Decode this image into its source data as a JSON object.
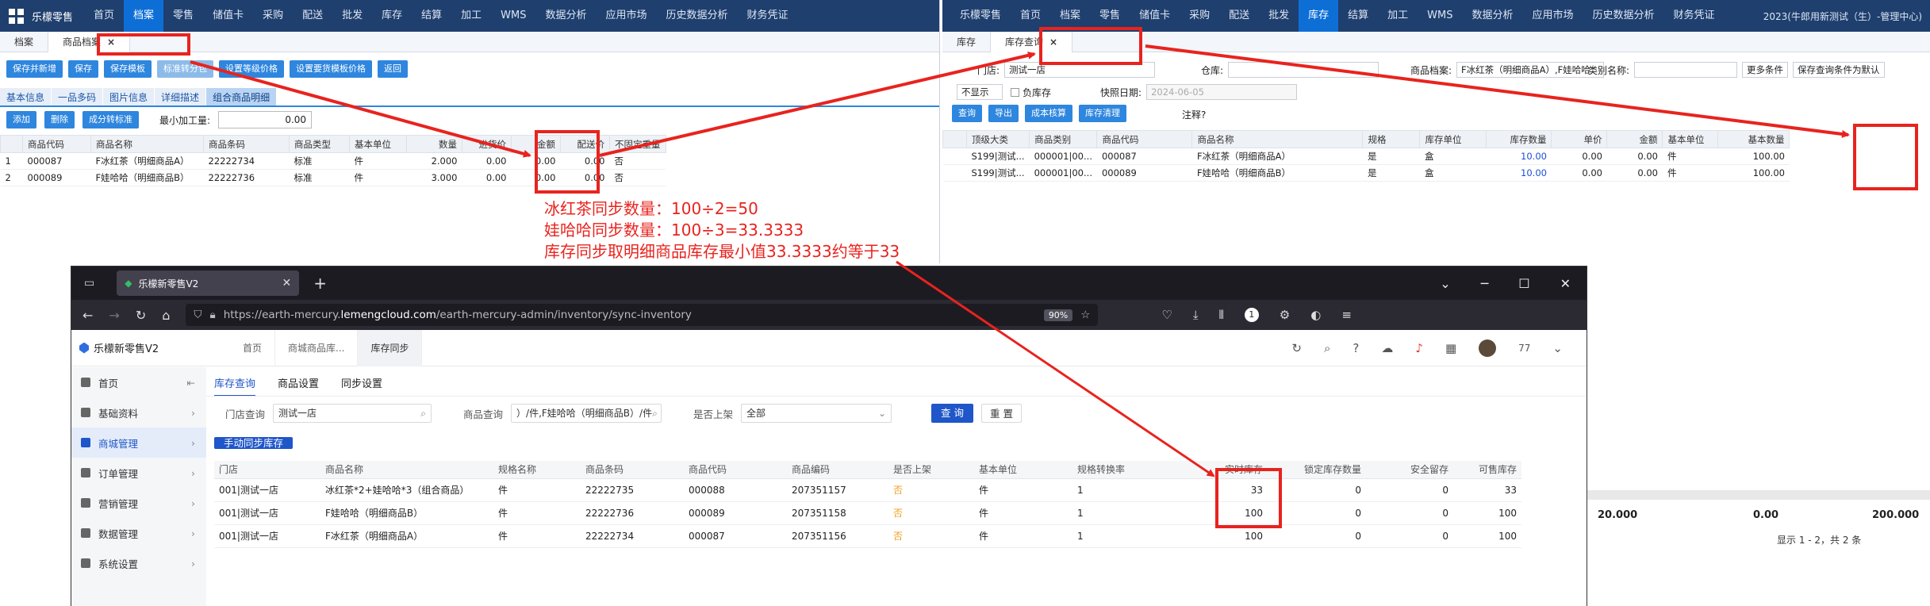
{
  "erp_left": {
    "brand": "乐檬零售",
    "menu": [
      "首页",
      "档案",
      "零售",
      "储值卡",
      "采购",
      "配送",
      "批发",
      "库存",
      "结算",
      "加工",
      "WMS",
      "数据分析",
      "应用市场",
      "历史数据分析",
      "财务凭证"
    ],
    "active_menu": "档案",
    "tabs": [
      "档案",
      "商品档案"
    ],
    "toolbar": [
      "保存并新增",
      "保存",
      "保存模板",
      "标准转分包",
      "设置等级价格",
      "设置要货模板价格",
      "返回"
    ],
    "subtabs": [
      "基本信息",
      "一品多码",
      "图片信息",
      "详细描述",
      "组合商品明细"
    ],
    "row_buttons": [
      "添加",
      "删除",
      "成分转标准"
    ],
    "min_qty_label": "最小加工量:",
    "min_qty_value": "0.00",
    "columns": [
      "",
      "商品代码",
      "商品名称",
      "商品条码",
      "商品类型",
      "基本单位",
      "数量",
      "进货价",
      "金额",
      "配送价",
      "不固定重量"
    ],
    "rows": [
      [
        "1",
        "000087",
        "F冰红茶（明细商品A）",
        "22222734",
        "标准",
        "件",
        "2.000",
        "0.00",
        "0.00",
        "0.00",
        "否"
      ],
      [
        "2",
        "000089",
        "F娃哈哈（明细商品B）",
        "22222736",
        "标准",
        "件",
        "3.000",
        "0.00",
        "0.00",
        "0.00",
        "否"
      ]
    ]
  },
  "erp_right": {
    "menu": [
      "乐檬零售",
      "首页",
      "档案",
      "零售",
      "储值卡",
      "采购",
      "配送",
      "批发",
      "库存",
      "结算",
      "加工",
      "WMS",
      "数据分析",
      "应用市场",
      "历史数据分析",
      "财务凭证"
    ],
    "active_menu": "库存",
    "header_right": "2023(牛郎用新测试（生）-管理中心)",
    "tabs": [
      "库存",
      "库存查询"
    ],
    "store_label": "门店:",
    "store_value": "测试一店",
    "warehouse_label": "仓库:",
    "product_label": "商品档案:",
    "product_value": "F冰红茶（明细商品A）,F娃哈哈",
    "category_label": "类别名称:",
    "more_conditions": "更多条件",
    "save_default": "保存查询条件为默认",
    "hide_select": "不显示",
    "negative_stock": "负库存",
    "snapshot_label": "快照日期:",
    "snapshot_value": "2024-06-05",
    "buttons": [
      "查询",
      "导出",
      "成本核算",
      "库存清理"
    ],
    "note": "注释?",
    "columns": [
      "",
      "顶级大类",
      "商品类别",
      "商品代码",
      "商品名称",
      "规格",
      "库存单位",
      "库存数量",
      "单价",
      "金额",
      "基本单位",
      "基本数量"
    ],
    "rows": [
      [
        "",
        "S199|测试...",
        "000001|00...",
        "000087",
        "F冰红茶（明细商品A）",
        "是",
        "盒",
        "10.00",
        "0.00",
        "0.00",
        "件",
        "100.00"
      ],
      [
        "",
        "S199|测试...",
        "000001|00...",
        "000089",
        "F娃哈哈（明细商品B）",
        "是",
        "盒",
        "10.00",
        "0.00",
        "0.00",
        "件",
        "100.00"
      ]
    ],
    "footer_values": [
      "20.000",
      "0.00",
      "200.000"
    ],
    "footer_page": "显示 1 - 2，共 2 条"
  },
  "browser": {
    "tab_title": "乐檬新零售V2",
    "url_prefix": "https://earth-mercury.",
    "url_host": "lemengcloud.com",
    "url_path": "/earth-mercury-admin/inventory/sync-inventory",
    "zoom": "90%",
    "notif_count": "1"
  },
  "app": {
    "logo": "乐檬新零售V2",
    "tabs": [
      "首页",
      "商城商品库...",
      "库存同步"
    ],
    "user": "77",
    "sidebar": [
      {
        "label": "首页",
        "arrow": "⇤"
      },
      {
        "label": "基础资料",
        "arrow": "›"
      },
      {
        "label": "商城管理",
        "arrow": "›"
      },
      {
        "label": "订单管理",
        "arrow": "›"
      },
      {
        "label": "营销管理",
        "arrow": "›"
      },
      {
        "label": "数据管理",
        "arrow": "›"
      },
      {
        "label": "系统设置",
        "arrow": "›"
      }
    ],
    "active_sidebar": "商城管理",
    "page_tabs": [
      "库存查询",
      "商品设置",
      "同步设置"
    ],
    "filters": {
      "store_label": "门店查询",
      "store_value": "测试一店",
      "product_label": "商品查询",
      "product_value": "）/件,F娃哈哈（明细商品B）/件",
      "listed_label": "是否上架",
      "listed_value": "全部",
      "search": "查 询",
      "reset": "重 置"
    },
    "sync_button": "手动同步库存",
    "columns": [
      "门店",
      "商品名称",
      "规格名称",
      "商品条码",
      "商品代码",
      "商品编码",
      "是否上架",
      "基本单位",
      "规格转换率",
      "实时库存",
      "锁定库存数量",
      "安全留存",
      "可售库存"
    ],
    "rows": [
      [
        "001|测试一店",
        "冰红茶*2+娃哈哈*3（组合商品）",
        "件",
        "22222735",
        "000088",
        "207351157",
        "否",
        "件",
        "1",
        "33",
        "0",
        "0",
        "33"
      ],
      [
        "001|测试一店",
        "F娃哈哈（明细商品B）",
        "件",
        "22222736",
        "000089",
        "207351158",
        "否",
        "件",
        "1",
        "100",
        "0",
        "0",
        "100"
      ],
      [
        "001|测试一店",
        "F冰红茶（明细商品A）",
        "件",
        "22222734",
        "000087",
        "207351156",
        "否",
        "件",
        "1",
        "100",
        "0",
        "0",
        "100"
      ]
    ]
  },
  "annotation": {
    "line1": "冰红茶同步数量：100÷2=50",
    "line2": "娃哈哈同步数量：100÷3=33.3333",
    "line3": "库存同步取明细商品库存最小值33.3333约等于33",
    "color": "#e8231e"
  }
}
